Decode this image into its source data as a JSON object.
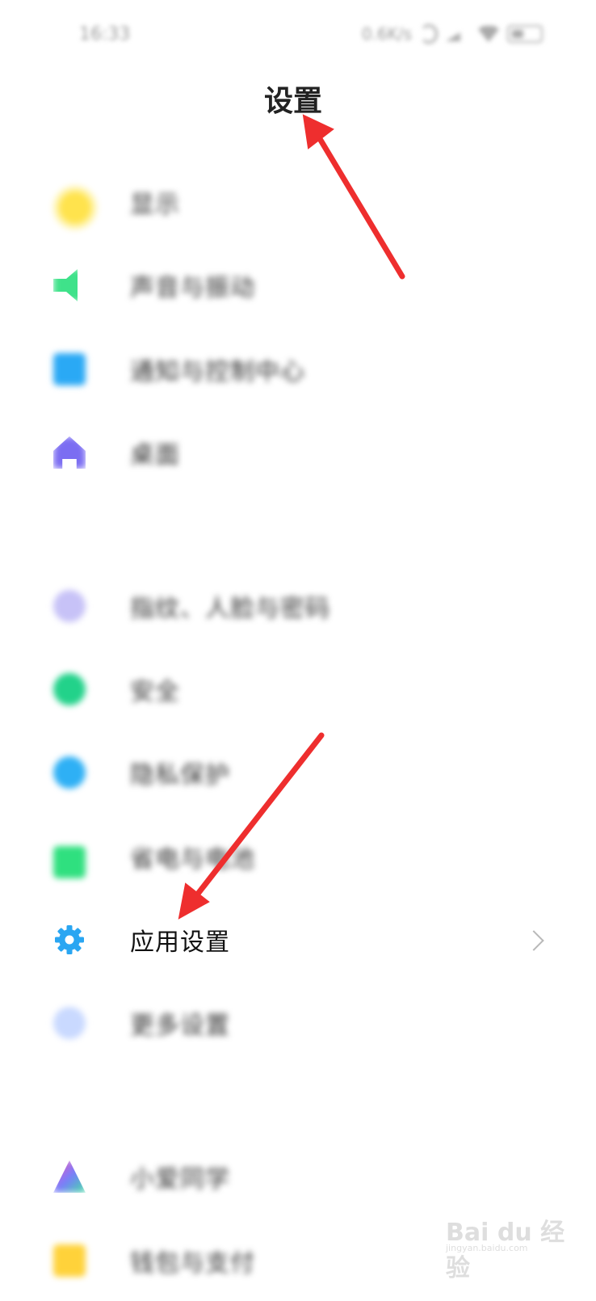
{
  "status_bar": {
    "time": "16:33",
    "speed": "0.6K/s",
    "battery": "86"
  },
  "header": {
    "title": "设置"
  },
  "settings": {
    "items": [
      {
        "label": "显示",
        "icon": "sun-icon"
      },
      {
        "label": "声音与振动",
        "icon": "speaker-icon"
      },
      {
        "label": "通知与控制中心",
        "icon": "notification-icon"
      },
      {
        "label": "桌面",
        "icon": "home-icon"
      },
      {
        "label": "指纹、人脸与密码",
        "icon": "fingerprint-icon"
      },
      {
        "label": "安全",
        "icon": "shield-icon"
      },
      {
        "label": "隐私保护",
        "icon": "privacy-icon"
      },
      {
        "label": "省电与电池",
        "icon": "battery-icon"
      },
      {
        "label": "应用设置",
        "icon": "gear-icon",
        "highlighted": true
      },
      {
        "label": "更多设置",
        "icon": "more-icon"
      },
      {
        "label": "小爱同学",
        "icon": "xiaoai-icon"
      },
      {
        "label": "钱包与支付",
        "icon": "wallet-icon"
      }
    ]
  },
  "annotation_color": "#ee2e2e",
  "watermark": {
    "text": "Bai du 经验",
    "sub": "jingyan.baidu.com"
  }
}
